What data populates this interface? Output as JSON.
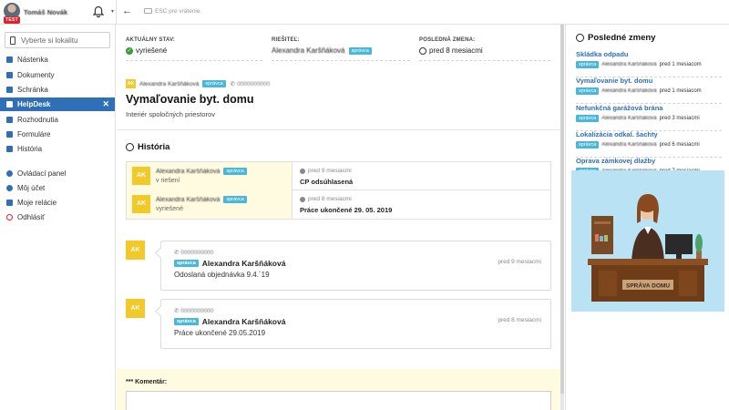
{
  "topbar": {
    "user_name": "Tomáš Novák",
    "test_badge": "TEST",
    "esc_hint": "ESC pre vrátenie"
  },
  "sidebar": {
    "location_placeholder": "Vyberte si lokalitu",
    "items": [
      {
        "label": "Nástenka",
        "icon": "home-icon"
      },
      {
        "label": "Dokumenty",
        "icon": "folder-icon"
      },
      {
        "label": "Schránka",
        "icon": "inbox-icon"
      },
      {
        "label": "HelpDesk",
        "icon": "helpdesk-icon",
        "active": true,
        "close": "✕"
      },
      {
        "label": "Rozhodnutia",
        "icon": "gavel-icon"
      },
      {
        "label": "Formuláre",
        "icon": "form-icon"
      },
      {
        "label": "História",
        "icon": "history-icon"
      },
      {
        "label": "Ovládací panel",
        "icon": "gear-icon"
      },
      {
        "label": "Môj účet",
        "icon": "user-icon"
      },
      {
        "label": "Moje relácie",
        "icon": "session-icon"
      },
      {
        "label": "Odhlásiť",
        "icon": "power-icon"
      }
    ]
  },
  "status": {
    "state_label": "AKTUÁLNY STAV:",
    "state_value": "vyriešené",
    "assignee_label": "RIEŠITEĽ:",
    "assignee_value": "Alexandra Karšňáková",
    "assignee_badge": "správca",
    "changed_label": "POSLEDNÁ ZMENA:",
    "changed_value": "pred 8 mesiacmi"
  },
  "ticket": {
    "author_initials": "AK",
    "author_name": "Alexandra Karšňáková",
    "author_badge": "správca",
    "author_phone": "0000000000",
    "title": "Vymaľovanie byt. domu",
    "subtitle": "Interiér spoločných priestorov"
  },
  "history": {
    "title": "História",
    "rows": [
      {
        "initials": "AK",
        "name": "Alexandra Karšňáková",
        "badge": "správca",
        "state": "v riešení",
        "time": "pred 9 mesiacmi",
        "text": "CP odsúhlasená"
      },
      {
        "initials": "AK",
        "name": "Alexandra Karšňáková",
        "badge": "správca",
        "state": "vyriešené",
        "time": "pred 8 mesiacmi",
        "text": "Práce ukončené 29. 05. 2019"
      }
    ]
  },
  "comments": [
    {
      "initials": "AK",
      "phone": "0000000000",
      "badge": "správca",
      "name": "Alexandra Karšňáková",
      "time": "pred 9 mesiacmi",
      "text": "Odoslaná objednávka 9.4.´19"
    },
    {
      "initials": "AK",
      "phone": "0000000000",
      "badge": "správca",
      "name": "Alexandra Karšňáková",
      "time": "pred 8 mesiacmi",
      "text": "Práce ukončené 29.05.2019"
    }
  ],
  "comment_form": {
    "label": "*** Komentár:"
  },
  "recent": {
    "title": "Posledné zmeny",
    "items": [
      {
        "title": "Skládka odpadu",
        "badge": "správca",
        "name": "Alexandra Karšňáková",
        "time": "pred 1 mesiacom"
      },
      {
        "title": "Vymaľovanie byt. domu",
        "badge": "správca",
        "name": "Alexandra Karšňáková",
        "time": "pred 1 mesiacom"
      },
      {
        "title": "Nefunkčná garážová brána",
        "badge": "správca",
        "name": "Alexandra Karšňáková",
        "time": "pred 3 mesiacmi"
      },
      {
        "title": "Lokalizácia odkal. šachty",
        "badge": "správca",
        "name": "Alexandra Karšňáková",
        "time": "pred 6 mesiacmi"
      },
      {
        "title": "Oprava zámkovej dlažby",
        "badge": "správca",
        "name": "Alexandra Karšňáková",
        "time": "pred 7 mesiacmi"
      }
    ],
    "illustration_sign": "SPRÁVA DOMU"
  },
  "colors": {
    "accent": "#2f6fb8",
    "badge": "#4ab7d8",
    "avatar": "#f2c928",
    "highlight": "#fffbe0"
  }
}
